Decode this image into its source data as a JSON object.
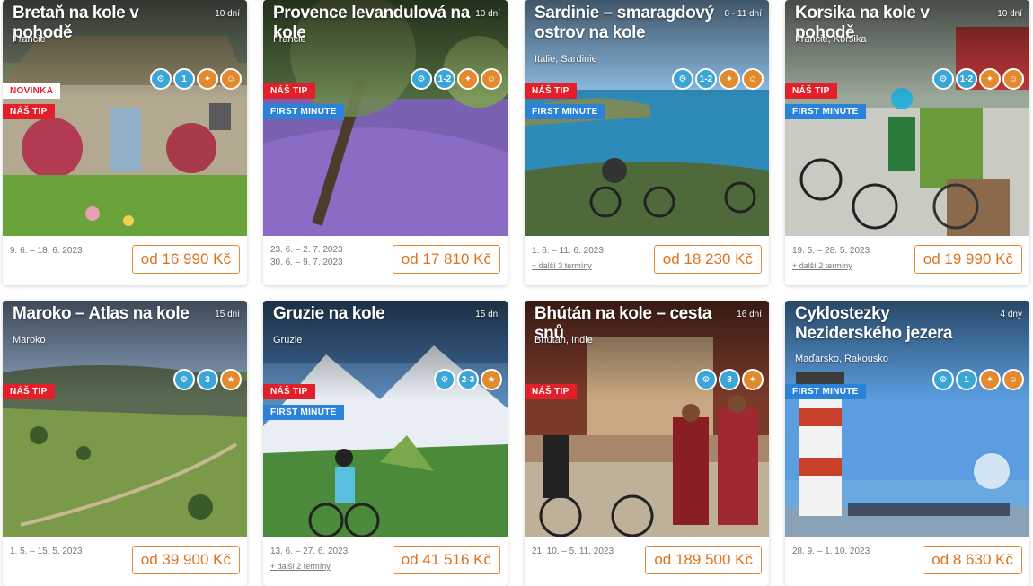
{
  "colors": {
    "badge_red": "#e3202a",
    "badge_blue": "#2a83d8",
    "icon_blue": "#3aa6d8",
    "icon_orange": "#e38a2f",
    "price_orange": "#e0711e"
  },
  "cards": [
    {
      "title": "Bretaň na kole v pohodě",
      "days": "10 dní",
      "country": "Francie",
      "badges": [
        "NOVINKA",
        "NÁŠ TIP"
      ],
      "dates": [
        "9. 6. – 18. 6. 2023"
      ],
      "more": "",
      "price": "od 16 990 Kč",
      "icons": [
        "bike-icon",
        "level-1-icon",
        "hotel-icon",
        "family-icon"
      ]
    },
    {
      "title": "Provence levandulová na kole",
      "days": "10 dní",
      "country": "Francie",
      "badges": [
        "NÁŠ TIP",
        "FIRST MINUTE"
      ],
      "dates": [
        "23. 6. – 2. 7. 2023",
        "30. 6. – 9. 7. 2023"
      ],
      "more": "",
      "price": "od 17 810 Kč",
      "icons": [
        "bike-icon",
        "level-1-2-icon",
        "hotel-icon",
        "family-icon"
      ]
    },
    {
      "title": "Sardinie – smaragdový ostrov na kole",
      "days": "8 - 11 dní",
      "country": "Itálie, Sardinie",
      "badges": [
        "NÁŠ TIP",
        "FIRST MINUTE"
      ],
      "dates": [
        "1. 6. – 11. 6. 2023"
      ],
      "more": "+ další 3 termíny",
      "price": "od 18 230 Kč",
      "icons": [
        "bike-icon",
        "level-1-2-icon",
        "hotel-icon",
        "family-icon"
      ]
    },
    {
      "title": "Korsika na kole v pohodě",
      "days": "10 dní",
      "country": "Francie, Korsika",
      "badges": [
        "NÁŠ TIP",
        "FIRST MINUTE"
      ],
      "dates": [
        "19. 5. – 28. 5. 2023"
      ],
      "more": "+ další 2 termíny",
      "price": "od 19 990 Kč",
      "icons": [
        "bike-icon",
        "level-1-2-icon",
        "hotel-icon",
        "family-icon"
      ]
    },
    {
      "title": "Maroko – Atlas na kole",
      "days": "15 dní",
      "country": "Maroko",
      "badges": [
        "NÁŠ TIP"
      ],
      "dates": [
        "1. 5. – 15. 5. 2023"
      ],
      "more": "",
      "price": "od 39 900 Kč",
      "icons": [
        "bike-icon",
        "level-3-icon",
        "stars-icon"
      ]
    },
    {
      "title": "Gruzie na kole",
      "days": "15 dní",
      "country": "Gruzie",
      "badges": [
        "NÁŠ TIP",
        "FIRST MINUTE"
      ],
      "dates": [
        "13. 6. – 27. 6. 2023"
      ],
      "more": "+ další 2 termíny",
      "price": "od 41 516 Kč",
      "icons": [
        "bike-icon",
        "level-2-3-icon",
        "stars-icon"
      ]
    },
    {
      "title": "Bhútán na kole – cesta snů",
      "days": "16 dní",
      "country": "Bhútán, Indie",
      "badges": [
        "NÁŠ TIP"
      ],
      "dates": [
        "21. 10. – 5. 11. 2023"
      ],
      "more": "",
      "price": "od 189 500 Kč",
      "icons": [
        "bike-icon",
        "level-3-icon",
        "hotel-icon"
      ]
    },
    {
      "title": "Cyklostezky Neziderského jezera",
      "days": "4 dny",
      "country": "Maďarsko, Rakousko",
      "badges": [
        "FIRST MINUTE"
      ],
      "dates": [
        "28. 9. – 1. 10. 2023"
      ],
      "more": "",
      "price": "od 8 630 Kč",
      "icons": [
        "bike-icon",
        "level-1-icon",
        "hotel-icon",
        "family-icon"
      ]
    }
  ]
}
